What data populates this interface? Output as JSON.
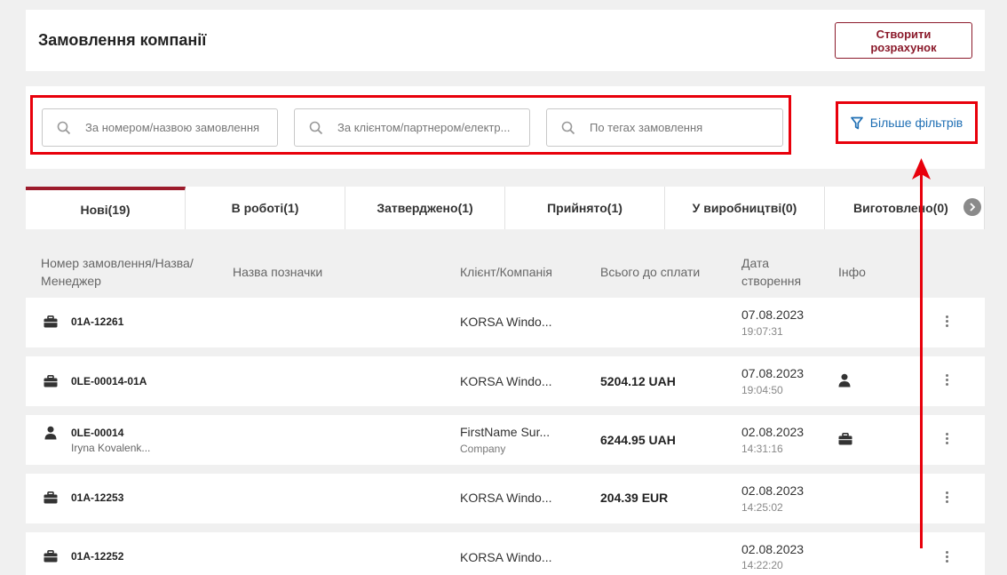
{
  "header": {
    "title": "Замовлення компанії",
    "create_button": "Створити розрахунок"
  },
  "search": {
    "by_number_placeholder": "За номером/назвою замовлення",
    "by_client_placeholder": "За клієнтом/партнером/електр...",
    "by_tags_placeholder": "По тегах замовлення",
    "more_filters": "Більше фільтрів"
  },
  "tabs": [
    {
      "label": "Нові",
      "count": "(19)"
    },
    {
      "label": "В роботі",
      "count": "(1)"
    },
    {
      "label": "Затверджено",
      "count": "(1)"
    },
    {
      "label": "Прийнято",
      "count": "(1)"
    },
    {
      "label": "У виробництві",
      "count": "(0)"
    },
    {
      "label": "Виготовлено",
      "count": "(0)"
    }
  ],
  "columns": {
    "order": "Номер замовлення/Назва/ Менеджер",
    "mark": "Назва позначки",
    "client": "Клієнт/Компанія",
    "total": "Всього до сплати",
    "date": "Дата створення",
    "info": "Інфо"
  },
  "rows": [
    {
      "icon": "briefcase-icon",
      "number": "01A-12261",
      "manager": "",
      "client": "KORSA Windo...",
      "company": "",
      "total": "",
      "date": "07.08.2023",
      "time": "19:07:31",
      "info_icon": ""
    },
    {
      "icon": "briefcase-icon",
      "number": "0LE-00014-01A",
      "manager": "",
      "client": "KORSA Windo...",
      "company": "",
      "total": "5204.12 UAH",
      "date": "07.08.2023",
      "time": "19:04:50",
      "info_icon": "person-icon"
    },
    {
      "icon": "person-icon",
      "number": "0LE-00014",
      "manager": "Iryna Kovalenk...",
      "client": "FirstName Sur...",
      "company": "Company",
      "total": "6244.95 UAH",
      "date": "02.08.2023",
      "time": "14:31:16",
      "info_icon": "briefcase-icon"
    },
    {
      "icon": "briefcase-icon",
      "number": "01A-12253",
      "manager": "",
      "client": "KORSA Windo...",
      "company": "",
      "total": "204.39 EUR",
      "date": "02.08.2023",
      "time": "14:25:02",
      "info_icon": ""
    },
    {
      "icon": "briefcase-icon",
      "number": "01A-12252",
      "manager": "",
      "client": "KORSA Windo...",
      "company": "",
      "total": "",
      "date": "02.08.2023",
      "time": "14:22:20",
      "info_icon": ""
    }
  ],
  "colors": {
    "accent": "#9c1b2c",
    "link": "#1f6fb4",
    "annotation": "#e8000b"
  }
}
